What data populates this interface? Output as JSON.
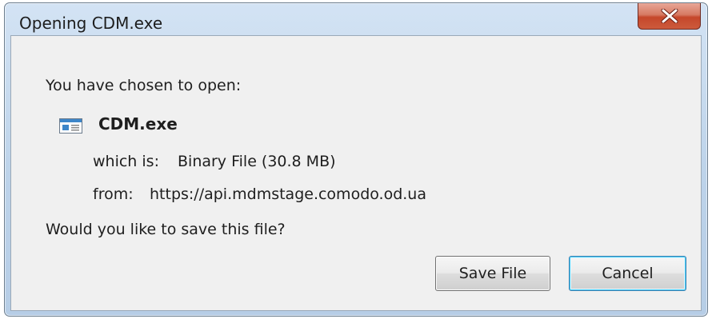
{
  "window": {
    "title": "Opening CDM.exe"
  },
  "dialog": {
    "prompt": "You have chosen to open:",
    "file": {
      "name": "CDM.exe",
      "icon": "application-file-icon",
      "which_is_label": "which is:",
      "which_is_value": "Binary File (30.8 MB)",
      "from_label": "from:",
      "from_value": "https://api.mdmstage.comodo.od.ua"
    },
    "question": "Would you like to save this file?"
  },
  "buttons": {
    "save_label": "Save File",
    "cancel_label": "Cancel"
  }
}
